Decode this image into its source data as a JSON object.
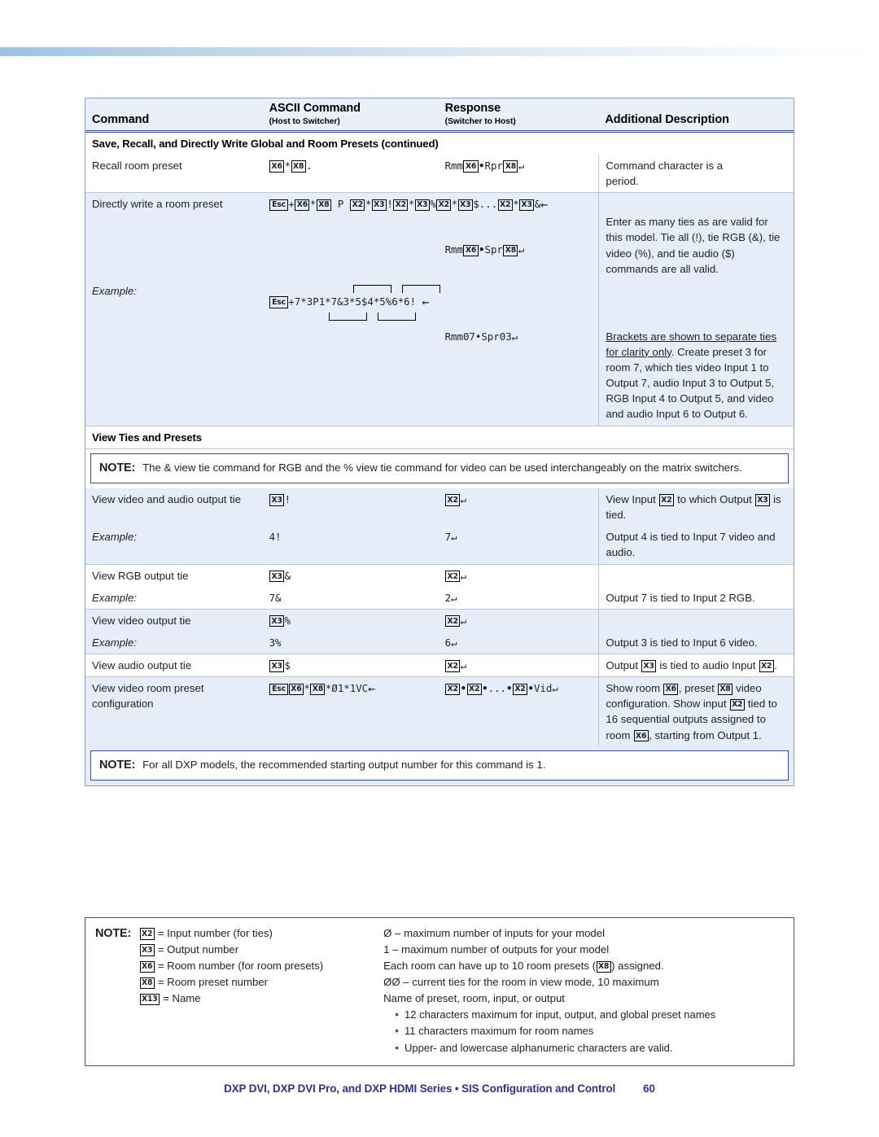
{
  "table": {
    "headers": [
      {
        "main": "Command",
        "sub": ""
      },
      {
        "main": "ASCII Command",
        "sub": "(Host to Switcher)"
      },
      {
        "main": "Response",
        "sub": "(Switcher to Host)"
      },
      {
        "main": "Additional Description",
        "sub": ""
      }
    ],
    "section1_title": "Save, Recall, and Directly Write Global and Room Presets (continued)",
    "rows": {
      "recall": {
        "command": "Recall room preset",
        "ascii_prefix": "",
        "response_prefix": "Rmm",
        "response_mid": "Rpr",
        "desc_line1": "Command character is a",
        "desc_line2": "period."
      },
      "directly_write": {
        "command": "Directly write a room preset",
        "response_prefix": "Rmm",
        "response_mid": "Spr",
        "desc": "Enter as many ties as are valid for this model. Tie all (!), tie RGB (&), tie video (%), and tie audio ($) commands are all valid."
      },
      "example_write": {
        "label": "Example:",
        "ascii": "+7*3P1*7&3*5$4*5%6*6!",
        "response": "Rmm07•Spr03",
        "desc_underlined": "Brackets are shown to separate ties for clarity only",
        "desc_rest": ". Create preset 3 for room 7, which ties video Input 1 to Output 7, audio Input 3 to Output 5, RGB Input 4 to Output 5, and video and audio Input 6 to Output 6."
      }
    },
    "section2_title": "View Ties and Presets",
    "note1": {
      "label": "NOTE:",
      "text": "The & view tie command for RGB and the % view tie command for video can be used interchangeably on the matrix switchers."
    },
    "view_rows": [
      {
        "command": "View video and audio output tie",
        "ascii_suffix": "!",
        "ascii_var": "X3",
        "response_var": "X2",
        "desc_pre": "View Input",
        "desc_mid": "to which Output",
        "desc_post": "is tied.",
        "desc_var1": "X2",
        "desc_var2": "X3",
        "example_label": "Example:",
        "example_ascii": "4!",
        "example_response": "7",
        "example_desc": "Output 4 is tied to Input 7 video and audio."
      },
      {
        "command": "View RGB output tie",
        "ascii_suffix": "&",
        "ascii_var": "X3",
        "response_var": "X2",
        "desc_pre": "",
        "example_label": "Example:",
        "example_ascii": "7&",
        "example_response": "2",
        "example_desc": "Output 7 is tied to Input 2 RGB."
      },
      {
        "command": "View video output tie",
        "ascii_suffix": "%",
        "ascii_var": "X3",
        "response_var": "X2",
        "desc_pre": "",
        "example_label": "Example:",
        "example_ascii": "3%",
        "example_response": "6",
        "example_desc": "Output 3 is tied to Input 6 video."
      }
    ],
    "audio_row": {
      "command": "View audio output tie",
      "ascii_var": "X3",
      "ascii_suffix": "$",
      "response_var": "X2",
      "desc_pre": "Output",
      "desc_mid": "is tied to audio Input",
      "desc_post": ".",
      "desc_var1": "X3",
      "desc_var2": "X2"
    },
    "room_preset_row": {
      "command_line1": "View video room preset",
      "command_line2": "configuration",
      "ascii_tail": "*Ø1*1VC",
      "response_tail": "Vid",
      "desc_pre": "Show room",
      "desc_mid": ", preset",
      "desc_line2": "video configuration. Show",
      "desc_line3_pre": "input",
      "desc_line3_post": "tied to 16 sequential",
      "desc_line4_pre": "outputs assigned to room",
      "desc_line4_post": ",",
      "desc_line5": "starting from Output 1."
    },
    "note2": {
      "label": "NOTE:",
      "text": "For all DXP models, the recommended starting output number for this command is 1."
    }
  },
  "legend": {
    "label": "NOTE:",
    "left": [
      {
        "var": "X2",
        "text": "= Input number (for ties)"
      },
      {
        "var": "X3",
        "text": "= Output number"
      },
      {
        "var": "X6",
        "text": "= Room number (for room presets)"
      },
      {
        "var": "X8",
        "text": "= Room preset number"
      },
      {
        "var": "X13",
        "text": "= Name"
      }
    ],
    "right": [
      "Ø – maximum number of inputs for your model",
      "1 – maximum number of outputs for your model",
      "Each room can have up to 10 room presets (X8) assigned.",
      "ØØ – current ties for the room in view mode, 10 maximum",
      "Name of preset, room, input, or output"
    ],
    "right_row3_pre": "Each room can have up to 10 room presets (",
    "right_row3_post": ") assigned.",
    "right_row3_var": "X8",
    "bullets": [
      "12 characters maximum for input, output, and global preset names",
      "11 characters maximum for room names",
      "Upper- and lowercase alphanumeric characters are valid."
    ]
  },
  "footer": {
    "title": "DXP DVI, DXP DVI Pro, and DXP HDMI Series • SIS Configuration and Control",
    "page_number": "60"
  },
  "glyphs": {
    "esc": "Esc",
    "x2": "X2",
    "x3": "X3",
    "x6": "X6",
    "x8": "X8",
    "x13": "X13",
    "return_arrow": "↵",
    "left_arrow": "←",
    "bullet": "•"
  },
  "colors": {
    "accent_blue": "#3b4da0",
    "row_blue": "#e4edf8",
    "header_blue": "#e9f0f8",
    "footer_blue": "#2e3192"
  }
}
